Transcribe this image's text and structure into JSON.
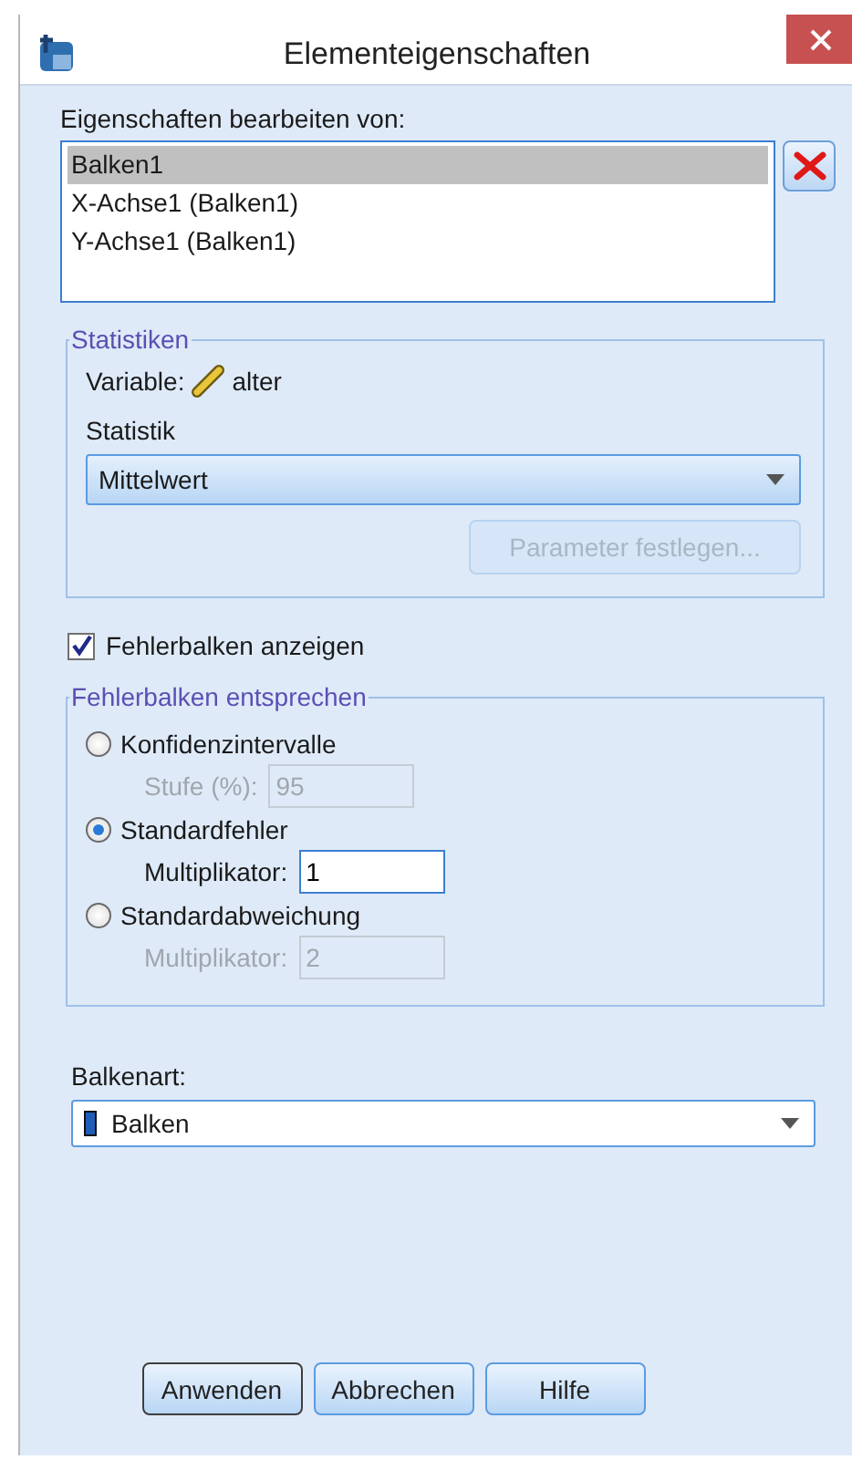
{
  "window": {
    "title": "Elementeigenschaften"
  },
  "edit_properties": {
    "label": "Eigenschaften bearbeiten von:",
    "items": [
      {
        "label": "Balken1",
        "selected": true
      },
      {
        "label": "X-Achse1 (Balken1)",
        "selected": false
      },
      {
        "label": "Y-Achse1 (Balken1)",
        "selected": false
      }
    ]
  },
  "statistics": {
    "legend": "Statistiken",
    "variable_label": "Variable:",
    "variable": "alter",
    "statistic_label": "Statistik",
    "statistic": "Mittelwert",
    "parameter_button": {
      "label": "Parameter festlegen...",
      "disabled": true
    }
  },
  "show_error_bars": {
    "label": "Fehlerbalken anzeigen",
    "checked": true
  },
  "error_bars_represent": {
    "legend": "Fehlerbalken entsprechen",
    "options": [
      {
        "label": "Konfidenzintervalle",
        "selected": false,
        "field_label": "Stufe (%):",
        "value": "95"
      },
      {
        "label": "Standardfehler",
        "selected": true,
        "field_label": "Multiplikator:",
        "value": "1"
      },
      {
        "label": "Standardabweichung",
        "selected": false,
        "field_label": "Multiplikator:",
        "value": "2"
      }
    ]
  },
  "bar_type": {
    "label": "Balkenart:",
    "value": "Balken"
  },
  "buttons": [
    {
      "label": "Anwenden",
      "default": true
    },
    {
      "label": "Abbrechen",
      "default": false
    },
    {
      "label": "Hilfe",
      "default": false
    }
  ]
}
